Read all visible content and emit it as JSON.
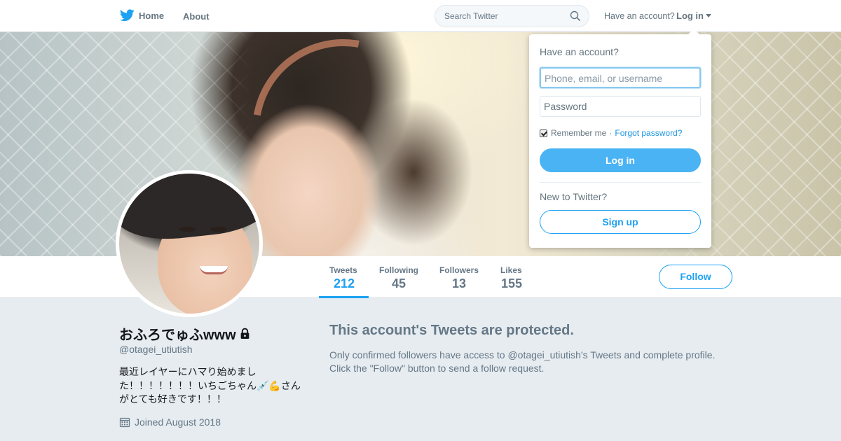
{
  "nav": {
    "home_label": "Home",
    "about_label": "About",
    "search_placeholder": "Search Twitter",
    "have_account": "Have an account?",
    "login_label": "Log in"
  },
  "login_dropdown": {
    "title": "Have an account?",
    "username_placeholder": "Phone, email, or username",
    "password_placeholder": "Password",
    "remember_label": "Remember me",
    "separator": "·",
    "forgot_label": "Forgot password?",
    "login_button": "Log in",
    "new_to_twitter": "New to Twitter?",
    "signup_button": "Sign up",
    "remember_checked": true
  },
  "profile_nav": {
    "stats": [
      {
        "label": "Tweets",
        "value": "212",
        "active": true
      },
      {
        "label": "Following",
        "value": "45",
        "active": false
      },
      {
        "label": "Followers",
        "value": "13",
        "active": false
      },
      {
        "label": "Likes",
        "value": "155",
        "active": false
      }
    ],
    "follow_button": "Follow"
  },
  "profile": {
    "name": "おふろでゅふwww",
    "handle": "@otagei_utiutish",
    "bio": "最近レイヤーにハマり始めました！！！！！！！いちごちゃん💉💪さんがとても好きです！！！",
    "joined": "Joined August 2018",
    "protected": true
  },
  "protected_message": {
    "title": "This account's Tweets are protected.",
    "text_line1": "Only confirmed followers have access to @otagei_utiutish's Tweets and complete profile.",
    "text_line2": "Click the \"Follow\" button to send a follow request."
  },
  "colors": {
    "accent": "#1da1f2",
    "background": "#e6ecf0",
    "muted": "#657786"
  },
  "icons": [
    "twitter-bird-icon",
    "search-icon",
    "caret-down-icon",
    "lock-icon",
    "calendar-icon"
  ]
}
